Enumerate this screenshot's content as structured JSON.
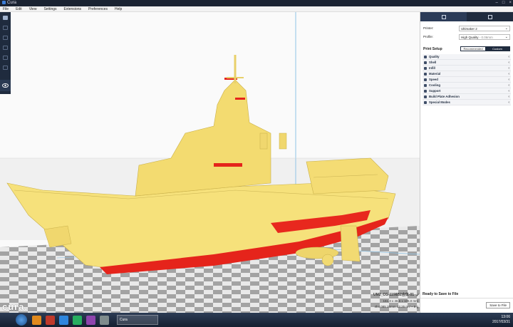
{
  "window": {
    "title": "Cura",
    "controls": [
      "–",
      "□",
      "×"
    ]
  },
  "menu": [
    "File",
    "Edit",
    "View",
    "Settings",
    "Extensions",
    "Preferences",
    "Help"
  ],
  "left_toolbar": {
    "icons": [
      "open-file-icon",
      "translate-icon",
      "scale-icon",
      "rotate-icon",
      "mirror-icon",
      "per-model-settings-icon",
      "view-mode-icon"
    ]
  },
  "logo": "cura.",
  "job": {
    "name": "UM2_CG-1198B2合体-01",
    "dimensions": "161.3 x 46.6 x 105.0 mm",
    "material_icon_text": "4h4 085 20mm",
    "time_weight": "13.25 m / ~ 9 g"
  },
  "panel": {
    "tabs": [
      "prepare-icon",
      "monitor-icon"
    ],
    "printer_label": "Printer:",
    "printer_value": "Ultimaker 2",
    "profile_label": "Profile:",
    "profile_value": "High Quality",
    "profile_sub": "- 0.06mm",
    "setup_title": "Print Setup",
    "mode_recommended": "Recommended",
    "mode_custom": "Custom",
    "categories": [
      "Quality",
      "Shell",
      "Infill",
      "Material",
      "Speed",
      "Cooling",
      "Support",
      "Build Plate Adhesion",
      "Special Modes"
    ],
    "status": "Ready to Save to File",
    "save_button": "Save to File"
  },
  "taskbar": {
    "active_window": "Cura",
    "time": "13:06",
    "date": "2017/03/31"
  },
  "colors": {
    "model": "#f5e27a",
    "overhang": "#e0201a",
    "panel_dark": "#1f2b3e",
    "grid_dark": "#9a9a9a",
    "grid_light": "#e8e8e8"
  }
}
